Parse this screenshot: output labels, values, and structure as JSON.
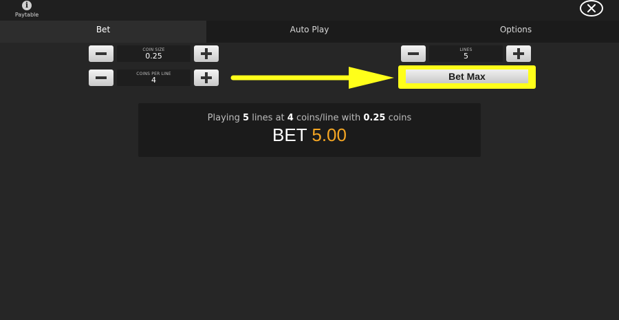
{
  "header": {
    "paytable_icon": "info-icon",
    "paytable_label": "Paytable",
    "close_icon": "close-icon"
  },
  "tabs": [
    {
      "label": "Bet",
      "active": true
    },
    {
      "label": "Auto Play",
      "active": false
    },
    {
      "label": "Options",
      "active": false
    }
  ],
  "bet_controls": {
    "coin_size": {
      "label": "COIN SIZE",
      "value": "0.25"
    },
    "coins_per_line": {
      "label": "COINS PER LINE",
      "value": "4"
    },
    "lines": {
      "label": "LINES",
      "value": "5"
    },
    "bet_max_label": "Bet Max"
  },
  "summary": {
    "pre": "Playing ",
    "lines": "5",
    "mid1": " lines at ",
    "coins": "4",
    "mid2": " coins/line with ",
    "coin_size": "0.25",
    "post": " coins",
    "bet_label": "BET ",
    "bet_amount": "5.00"
  },
  "colors": {
    "background": "#262626",
    "highlight": "#ffff1a",
    "bet_amount": "#f5a623"
  }
}
